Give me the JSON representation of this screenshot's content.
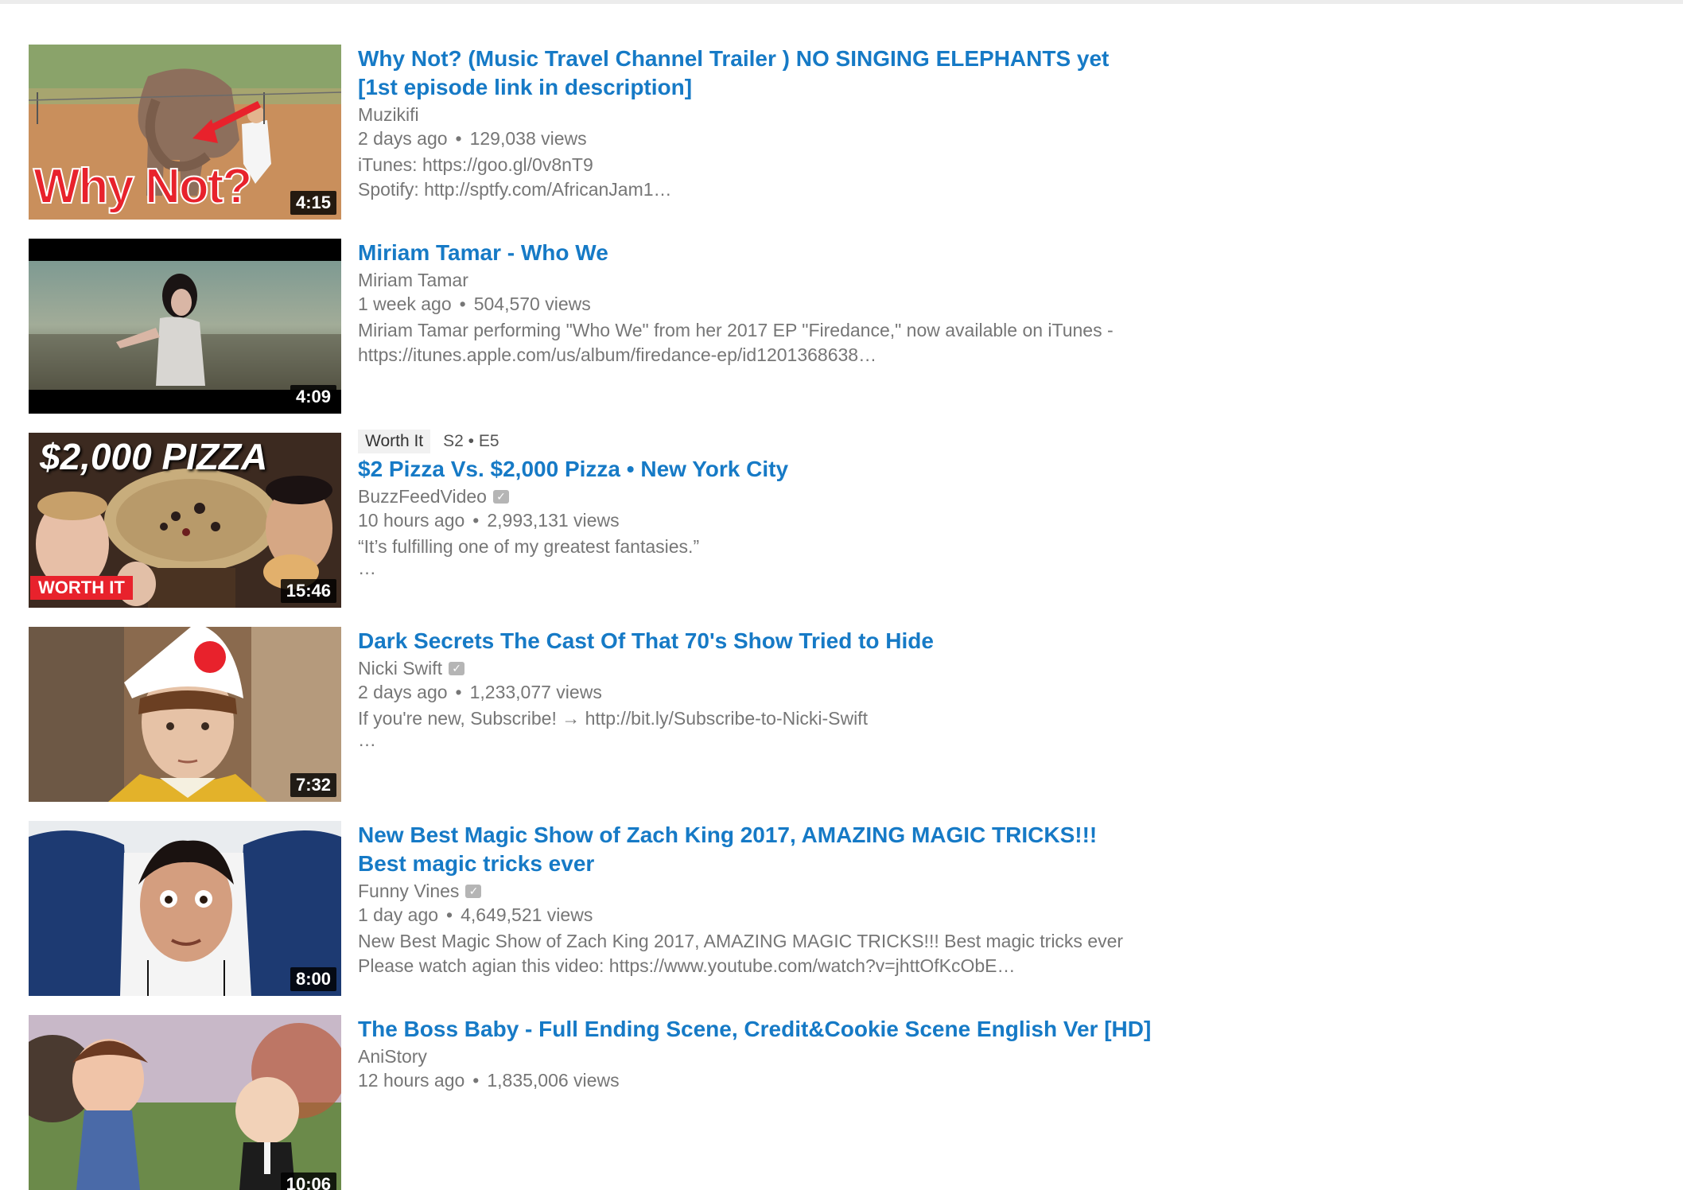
{
  "results": [
    {
      "title_line1": "Why Not? (Music Travel Channel Trailer ) NO SINGING ELEPHANTS yet",
      "title_line2": "[1st episode link in description]",
      "channel": "Muzikifi",
      "age": "2 days ago",
      "views": "129,038 views",
      "desc_line1": "iTunes: https://goo.gl/0v8nT9",
      "desc_line2": "Spotify: http://sptfy.com/AfricanJam1…",
      "duration": "4:15",
      "thumb_text": "Why Not?"
    },
    {
      "title_line1": "Miriam Tamar - Who We",
      "channel": "Miriam Tamar",
      "age": "1 week ago",
      "views": "504,570 views",
      "desc_line1": "Miriam Tamar performing \"Who We\" from her 2017 EP \"Firedance,\" now available on iTunes -",
      "desc_line2": "https://itunes.apple.com/us/album/firedance-ep/id1201368638…",
      "duration": "4:09"
    },
    {
      "show_badge": "Worth It",
      "episode": "S2 • E5",
      "title_line1": "$2 Pizza Vs. $2,000 Pizza • New York City",
      "channel": "BuzzFeedVideo",
      "age": "10 hours ago",
      "views": "2,993,131 views",
      "desc_line1": "“It’s fulfilling one of my greatest fantasies.”",
      "ellipsis": "…",
      "duration": "15:46",
      "thumb_text": "$2,000 PIZZA",
      "thumb_badge": "WORTH IT"
    },
    {
      "title_line1": "Dark Secrets The Cast Of That 70's Show Tried to Hide",
      "channel": "Nicki Swift",
      "age": "2 days ago",
      "views": "1,233,077 views",
      "desc_line1": "If you're new, Subscribe! → http://bit.ly/Subscribe-to-Nicki-Swift",
      "ellipsis": "…",
      "duration": "7:32"
    },
    {
      "title_line1": "New Best Magic Show of Zach King 2017, AMAZING MAGIC TRICKS!!!",
      "title_line2": "Best magic tricks ever",
      "channel": "Funny Vines",
      "age": "1 day ago",
      "views": "4,649,521 views",
      "desc_line1": "New Best Magic Show of Zach King 2017, AMAZING MAGIC TRICKS!!! Best magic tricks ever",
      "desc_line2": "Please watch agian this video: https://www.youtube.com/watch?v=jhttOfKcObE…",
      "duration": "8:00"
    },
    {
      "title_line1": "The Boss Baby - Full Ending Scene, Credit&Cookie Scene English Ver [HD]",
      "channel": "AniStory",
      "age": "12 hours ago",
      "views": "1,835,006 views",
      "duration": "10:06"
    }
  ],
  "separator": "•",
  "verified_icon": "check-badge-icon",
  "colors": {
    "title": "#167ac6",
    "meta": "#767676",
    "duration_bg": "#000000"
  }
}
